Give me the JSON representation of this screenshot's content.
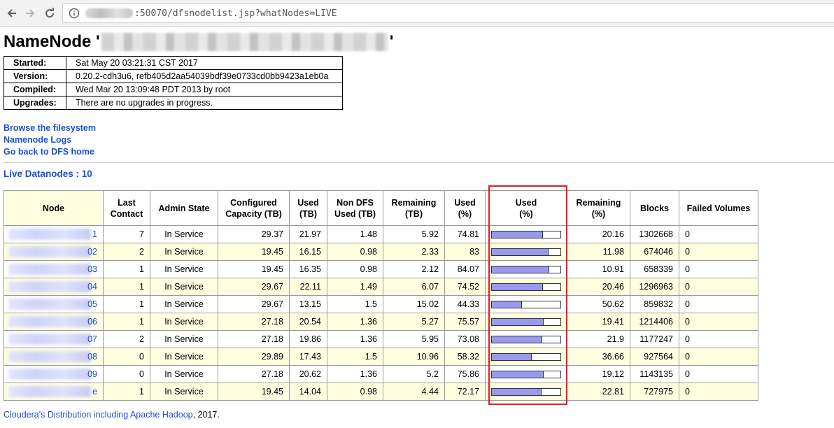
{
  "browser": {
    "url_text": ":50070/dfsnodelist.jsp?whatNodes=LIVE"
  },
  "page": {
    "title_prefix": "NameNode '",
    "title_suffix": "'",
    "info": [
      {
        "key": "Started:",
        "value": "Sat May 20 03:21:31 CST 2017"
      },
      {
        "key": "Version:",
        "value": "0.20.2-cdh3u6, refb405d2aa54039bdf39e0733cd0bb9423a1eb0a"
      },
      {
        "key": "Compiled:",
        "value": "Wed Mar 20 13:09:48 PDT 2013 by root"
      },
      {
        "key": "Upgrades:",
        "value": "There are no upgrades in progress."
      }
    ],
    "links": {
      "browse": "Browse the filesystem",
      "logs": "Namenode Logs",
      "home": "Go back to DFS home"
    },
    "live_label": "Live Datanodes : 10"
  },
  "table": {
    "headers": [
      [
        "Node"
      ],
      [
        "Last",
        "Contact"
      ],
      [
        "Admin State"
      ],
      [
        "Configured",
        "Capacity (TB)"
      ],
      [
        "Used",
        "(TB)"
      ],
      [
        "Non DFS",
        "Used (TB)"
      ],
      [
        "Remaining",
        "(TB)"
      ],
      [
        "Used",
        "(%)"
      ],
      [
        "Used",
        "(%)"
      ],
      [
        "Remaining",
        "(%)"
      ],
      [
        "Blocks"
      ],
      [
        "Failed Volumes"
      ]
    ],
    "rows": [
      {
        "node_suffix": "1",
        "last_contact": "7",
        "admin_state": "In Service",
        "capacity": "29.37",
        "used": "21.97",
        "non_dfs": "1.48",
        "remaining": "5.92",
        "used_pct": "74.81",
        "bar_fraction": 0.7481,
        "remaining_pct": "20.16",
        "blocks": "1302668",
        "failed": "0"
      },
      {
        "node_suffix": "02",
        "last_contact": "2",
        "admin_state": "In Service",
        "capacity": "19.45",
        "used": "16.15",
        "non_dfs": "0.98",
        "remaining": "2.33",
        "used_pct": "83",
        "bar_fraction": 0.83,
        "remaining_pct": "11.98",
        "blocks": "674046",
        "failed": "0"
      },
      {
        "node_suffix": "03",
        "last_contact": "1",
        "admin_state": "In Service",
        "capacity": "19.45",
        "used": "16.35",
        "non_dfs": "0.98",
        "remaining": "2.12",
        "used_pct": "84.07",
        "bar_fraction": 0.8407,
        "remaining_pct": "10.91",
        "blocks": "658339",
        "failed": "0"
      },
      {
        "node_suffix": "04",
        "last_contact": "1",
        "admin_state": "In Service",
        "capacity": "29.67",
        "used": "22.11",
        "non_dfs": "1.49",
        "remaining": "6.07",
        "used_pct": "74.52",
        "bar_fraction": 0.7452,
        "remaining_pct": "20.46",
        "blocks": "1296963",
        "failed": "0"
      },
      {
        "node_suffix": "05",
        "last_contact": "1",
        "admin_state": "In Service",
        "capacity": "29.67",
        "used": "13.15",
        "non_dfs": "1.5",
        "remaining": "15.02",
        "used_pct": "44.33",
        "bar_fraction": 0.4433,
        "remaining_pct": "50.62",
        "blocks": "859832",
        "failed": "0"
      },
      {
        "node_suffix": "06",
        "last_contact": "1",
        "admin_state": "In Service",
        "capacity": "27.18",
        "used": "20.54",
        "non_dfs": "1.36",
        "remaining": "5.27",
        "used_pct": "75.57",
        "bar_fraction": 0.7557,
        "remaining_pct": "19.41",
        "blocks": "1214406",
        "failed": "0"
      },
      {
        "node_suffix": "07",
        "last_contact": "2",
        "admin_state": "In Service",
        "capacity": "27.18",
        "used": "19.86",
        "non_dfs": "1.36",
        "remaining": "5.95",
        "used_pct": "73.08",
        "bar_fraction": 0.7308,
        "remaining_pct": "21.9",
        "blocks": "1177247",
        "failed": "0"
      },
      {
        "node_suffix": "08",
        "last_contact": "0",
        "admin_state": "In Service",
        "capacity": "29.89",
        "used": "17.43",
        "non_dfs": "1.5",
        "remaining": "10.96",
        "used_pct": "58.32",
        "bar_fraction": 0.5832,
        "remaining_pct": "36.66",
        "blocks": "927564",
        "failed": "0"
      },
      {
        "node_suffix": "09",
        "last_contact": "0",
        "admin_state": "In Service",
        "capacity": "27.18",
        "used": "20.62",
        "non_dfs": "1.36",
        "remaining": "5.2",
        "used_pct": "75.86",
        "bar_fraction": 0.7586,
        "remaining_pct": "19.12",
        "blocks": "1143135",
        "failed": "0"
      },
      {
        "node_suffix": "e",
        "last_contact": "1",
        "admin_state": "In Service",
        "capacity": "19.45",
        "used": "14.04",
        "non_dfs": "0.98",
        "remaining": "4.44",
        "used_pct": "72.17",
        "bar_fraction": 0.7217,
        "remaining_pct": "22.81",
        "blocks": "727975",
        "failed": "0"
      }
    ]
  },
  "footer": {
    "link": "Cloudera's Distribution including Apache Hadoop",
    "suffix": ", 2017."
  },
  "colors": {
    "link": "#1a4fd6",
    "row_highlight": "#ffffe0",
    "bar_fill": "#9999ee",
    "annotation_box": "#e02020"
  }
}
